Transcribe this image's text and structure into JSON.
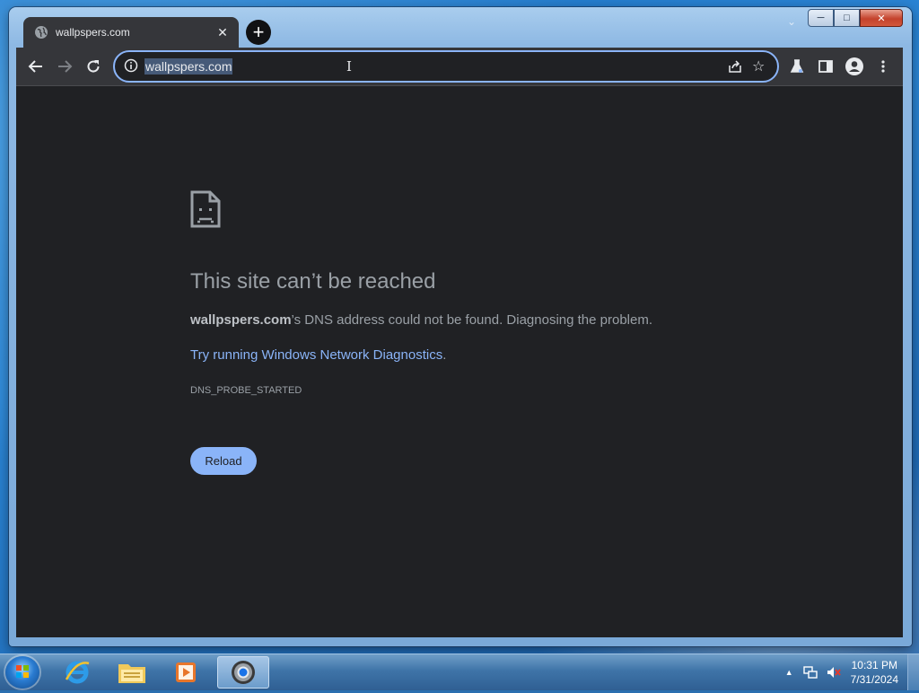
{
  "tabs": [
    {
      "title": "wallpspers.com",
      "favicon": "globe-icon"
    }
  ],
  "toolbar": {
    "url": "wallpspers.com"
  },
  "error_page": {
    "title": "This site can’t be reached",
    "host": "wallpspers.com",
    "message_rest": "’s DNS address could not be found. Diagnosing the problem.",
    "link_text": "Try running Windows Network Diagnostics",
    "link_suffix": ".",
    "error_code": "DNS_PROBE_STARTED",
    "reload_label": "Reload"
  },
  "taskbar": {
    "apps": [
      "internet-explorer-icon",
      "file-explorer-icon",
      "media-player-icon",
      "chrome-icon"
    ],
    "active_app": "chrome-icon"
  },
  "system_tray": {
    "time": "10:31 PM",
    "date": "7/31/2024"
  },
  "colors": {
    "page_background": "#202124",
    "toolbar": "#35363a",
    "accent_blue": "#8ab4f8",
    "text_secondary": "#9aa0a6"
  }
}
